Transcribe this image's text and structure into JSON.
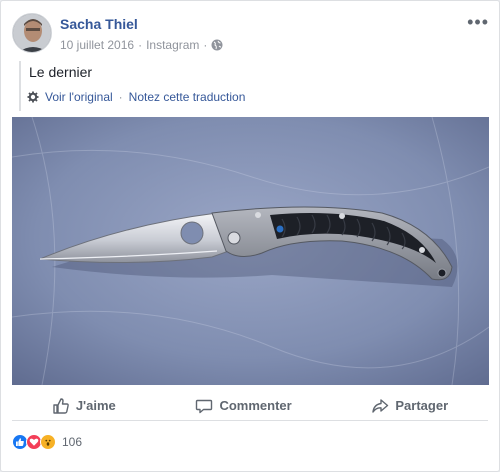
{
  "post": {
    "author": "Sacha Thiel",
    "date": "10 juillet 2016",
    "source": "Instagram",
    "separator": "·",
    "privacy_icon": "globe-icon",
    "more_label": "•••",
    "text": "Le dernier",
    "see_original": "Voir l'original",
    "rate_translation": "Notez cette traduction",
    "photo_subject": "folding-knife"
  },
  "actions": {
    "like": "J'aime",
    "comment": "Commenter",
    "share": "Partager"
  },
  "reactions": {
    "count": "106",
    "types": [
      "like",
      "love",
      "wow"
    ]
  },
  "colors": {
    "link": "#365899",
    "meta": "#90949c",
    "like_blue": "#1877f2",
    "love_red": "#f33e58",
    "wow_yellow": "#f7b125"
  }
}
